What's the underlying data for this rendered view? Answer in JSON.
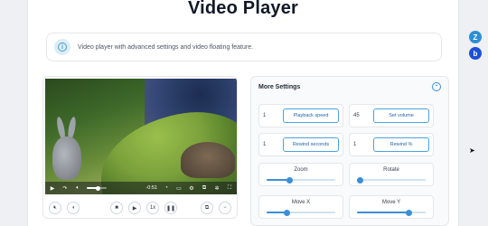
{
  "page": {
    "title": "Video Player",
    "info": "Video player with advanced settings and video floating feature."
  },
  "video": {
    "time": "-0:51",
    "speed_label": "1x",
    "volume_fraction": 0.55
  },
  "settings": {
    "header": "More Settings",
    "controls": [
      {
        "value": "1",
        "button": "Playback speed"
      },
      {
        "value": "45",
        "button": "Set volume"
      },
      {
        "value": "1",
        "button": "Rewind seconds"
      },
      {
        "value": "1",
        "button": "Rewind %"
      }
    ],
    "sliders": [
      {
        "label": "Zoom",
        "fraction": 0.33
      },
      {
        "label": "Rotate",
        "fraction": 0.05
      },
      {
        "label": "Move X",
        "fraction": 0.3
      },
      {
        "label": "Move Y",
        "fraction": 0.75
      }
    ]
  },
  "float_buttons": [
    {
      "icon": "z-badge-icon",
      "glyph": "Z",
      "color": "#2d8fd5"
    },
    {
      "icon": "b-badge-icon",
      "glyph": "b",
      "color": "#1e4fd6"
    }
  ]
}
